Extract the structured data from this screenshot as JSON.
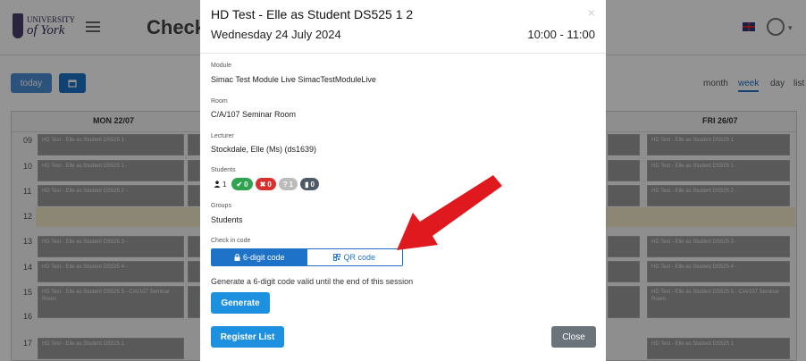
{
  "app": {
    "logo_line1": "UNIVERSITY",
    "logo_line2": "of York",
    "page_heading": "Check",
    "today_label": "today",
    "calendar_icon": "calendar-icon",
    "views": [
      "month",
      "week",
      "day",
      "list"
    ],
    "active_view": "week",
    "days": [
      "MON 22/07",
      "FRI 26/07"
    ],
    "hours": [
      "09",
      "10",
      "11",
      "12",
      "13",
      "14",
      "15",
      "16",
      "17"
    ],
    "events": [
      "HD Test - Elle as Student DS525 1",
      "HD Test - Elle as Student DS525 1 -",
      "HD Test - Elle as Student DS525 2 -",
      "HD Test - Elle as Student DS525 3 -",
      "HD Test - Elle as Student DS525 4 -",
      "HD Test - Elle as Student DS525 5 - C/A/107 Seminar Room"
    ]
  },
  "modal": {
    "title": "HD Test - Elle as Student DS525 1 2",
    "date": "Wednesday 24 July 2024",
    "time": "10:00 - 11:00",
    "close_symbol": "×",
    "module_label": "Module",
    "module_value": "Simac Test Module Live SimacTestModuleLive",
    "room_label": "Room",
    "room_value": "C/A/107 Seminar Room",
    "lecturer_label": "Lecturer",
    "lecturer_value": "Stockdale, Elle (Ms) (ds1639)",
    "students_label": "Students",
    "badges": {
      "total": "1",
      "present": "0",
      "absent": "0",
      "unknown": "1",
      "other": "0"
    },
    "groups_label": "Groups",
    "groups_value": "Students",
    "checkin_label": "Check in code",
    "tab_6digit": "6-digit code",
    "tab_qr": "QR code",
    "help_text": "Generate a 6-digit code valid until the end of this session",
    "generate_label": "Generate",
    "register_label": "Register List",
    "close_label": "Close"
  },
  "colors": {
    "primary": "#1e90e0",
    "arrow": "#e0191e",
    "close_button": "#6b737b"
  }
}
